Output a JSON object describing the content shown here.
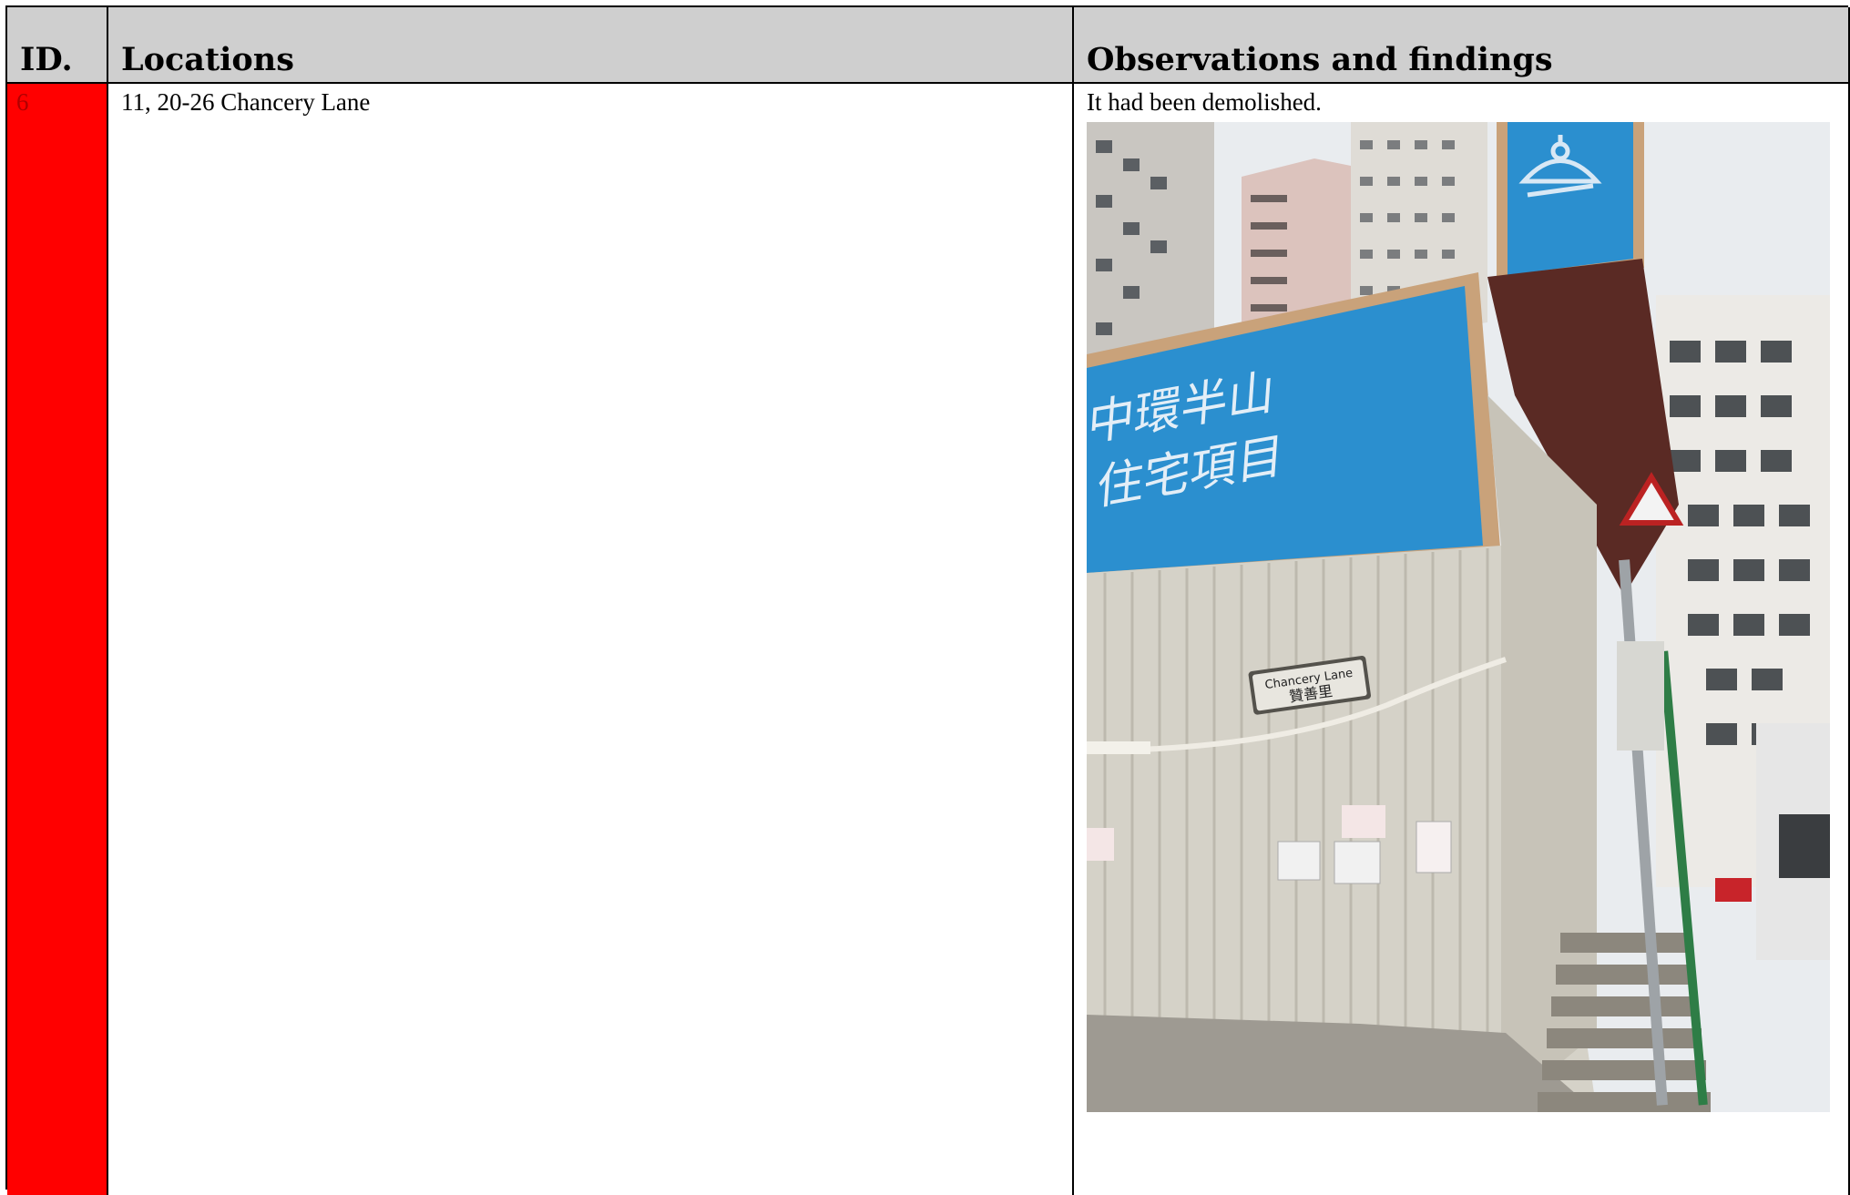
{
  "table": {
    "headers": {
      "id": "ID.",
      "location": "Locations",
      "observation": "Observations and findings"
    },
    "row": {
      "id": "6",
      "location": "11, 20-26 Chancery Lane",
      "observation": "It had been demolished."
    }
  },
  "photo": {
    "subject": "demolished-site-hoarding",
    "sign_text_1": "中環半山",
    "sign_text_2": "住宅項目",
    "street_sign_en": "Chancery Lane",
    "street_sign_zh": "贊善里",
    "colors": {
      "hoarding_blue": "#2b8fcf",
      "frame_tan": "#c9a27a",
      "row_red": "#ff0000"
    }
  }
}
